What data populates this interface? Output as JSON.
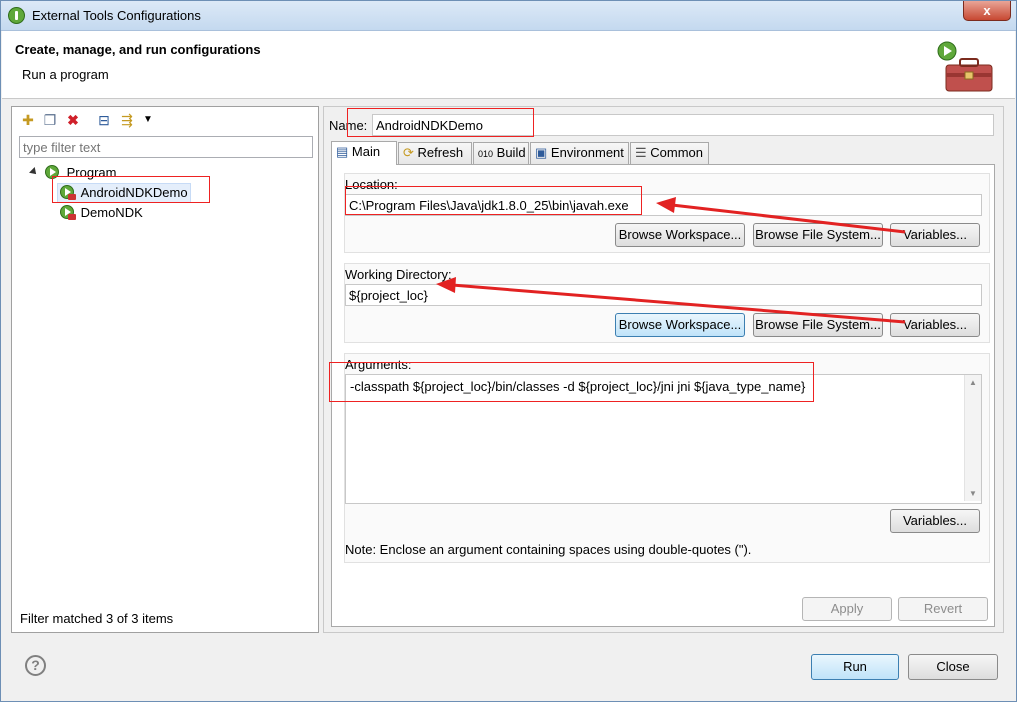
{
  "window": {
    "title": "External Tools Configurations",
    "close_glyph": "x"
  },
  "banner": {
    "title": "Create, manage, and run configurations",
    "subtitle": "Run a program"
  },
  "left": {
    "toolbar_icons": [
      "new-config-icon",
      "duplicate-icon",
      "delete-icon",
      "collapse-all-icon",
      "filter-icon",
      "dropdown-arrow-icon"
    ],
    "filter_placeholder": "type filter text",
    "tree": {
      "root_label": "Program",
      "children": [
        {
          "label": "AndroidNDKDemo",
          "selected": true
        },
        {
          "label": "DemoNDK",
          "selected": false
        }
      ]
    },
    "status": "Filter matched 3 of 3 items"
  },
  "right": {
    "name_label": "Name:",
    "name_value": "AndroidNDKDemo",
    "tabs": [
      {
        "label": "Main",
        "icon": "main-tab-icon",
        "active": true
      },
      {
        "label": "Refresh",
        "icon": "refresh-icon",
        "active": false
      },
      {
        "label": "Build",
        "icon": "build-icon",
        "active": false
      },
      {
        "label": "Environment",
        "icon": "environment-icon",
        "active": false
      },
      {
        "label": "Common",
        "icon": "common-icon",
        "active": false
      }
    ],
    "location": {
      "label": "Location:",
      "value": "C:\\Program Files\\Java\\jdk1.8.0_25\\bin\\javah.exe",
      "buttons": [
        "Browse Workspace...",
        "Browse File System...",
        "Variables..."
      ]
    },
    "working_dir": {
      "label": "Working Directory:",
      "value": "${project_loc}",
      "buttons": [
        "Browse Workspace...",
        "Browse File System...",
        "Variables..."
      ]
    },
    "arguments": {
      "label": "Arguments:",
      "value": "-classpath ${project_loc}/bin/classes -d ${project_loc}/jni jni ${java_type_name}",
      "variables_button": "Variables...",
      "note": "Note: Enclose an argument containing spaces using double-quotes (\")."
    },
    "apply_button": "Apply",
    "revert_button": "Revert"
  },
  "footer": {
    "help_glyph": "?",
    "run_button": "Run",
    "close_button": "Close"
  },
  "colors": {
    "annotation": "#e22222",
    "accent": "#3c7fb1"
  }
}
